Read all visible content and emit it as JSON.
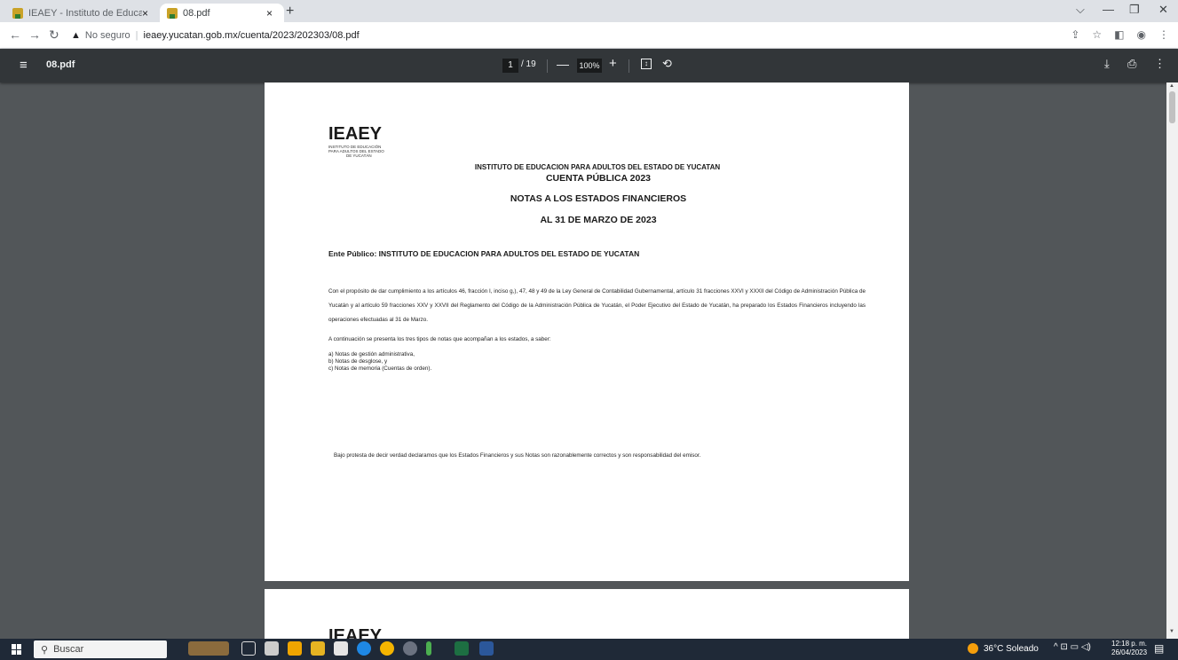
{
  "browser": {
    "tabs": [
      {
        "label": "IEAEY - Instituto de Educación pa"
      },
      {
        "label": "08.pdf"
      }
    ],
    "close_glyph": "×",
    "new_tab_glyph": "+",
    "address": {
      "security_label": "No seguro",
      "url": "ieaey.yucatan.gob.mx/cuenta/2023/202303/08.pdf"
    }
  },
  "pdf_toolbar": {
    "file_name": "08.pdf",
    "current_page": "1",
    "total_pages": "/ 19",
    "zoom": "100%",
    "zoom_minus": "—",
    "zoom_plus": "+"
  },
  "document": {
    "logo_text": "IEAEY",
    "logo_sub": [
      "INSTITUTO DE EDUCACIÓN",
      "PARA ADULTOS DEL ESTADO",
      "DE YUCATÁN"
    ],
    "heading_1": "INSTITUTO DE EDUCACION PARA ADULTOS DEL ESTADO DE YUCATAN",
    "heading_2": "CUENTA PÚBLICA 2023",
    "heading_3": "NOTAS A LOS ESTADOS FINANCIEROS",
    "heading_4": "AL 31 DE MARZO DE 2023",
    "ente_publico": "Ente Público: INSTITUTO DE EDUCACION PARA ADULTOS DEL ESTADO DE YUCATAN",
    "paragraph_1": "Con el propósito de dar cumplimiento a los artículos 46, fracción I, inciso g,), 47, 48 y 49 de la Ley General de Contabilidad Gubernamental, artículo 31 fracciones XXVI y XXXII del Código de Administración Pública de Yucatán y al artículo 59 fracciones XXV y XXVII del Reglamento del Código de la Administración Pública de Yucatán, el Poder Ejecutivo del Estado de Yucatán, ha preparado los Estados Financieros incluyendo las operaciones efectuadas al 31 de Marzo.",
    "paragraph_2": "A continuación se presenta los tres tipos de notas que acompañan a los estados, a saber:",
    "notes_list": [
      "a)  Notas de gestión administrativa,",
      "b)  Notas de desglose, y",
      "c)  Notas de memoria (Cuentas de orden)."
    ],
    "protesta": "Bajo protesta de decir verdad declaramos que los Estados Financieros y sus Notas son razonablemente correctos y son responsabilidad del emisor.",
    "next_page_logo": "IEAEY"
  },
  "taskbar": {
    "search_placeholder": "Buscar",
    "weather": "36°C  Soleado",
    "time": "12:18 p. m.",
    "date": "26/04/2023"
  }
}
